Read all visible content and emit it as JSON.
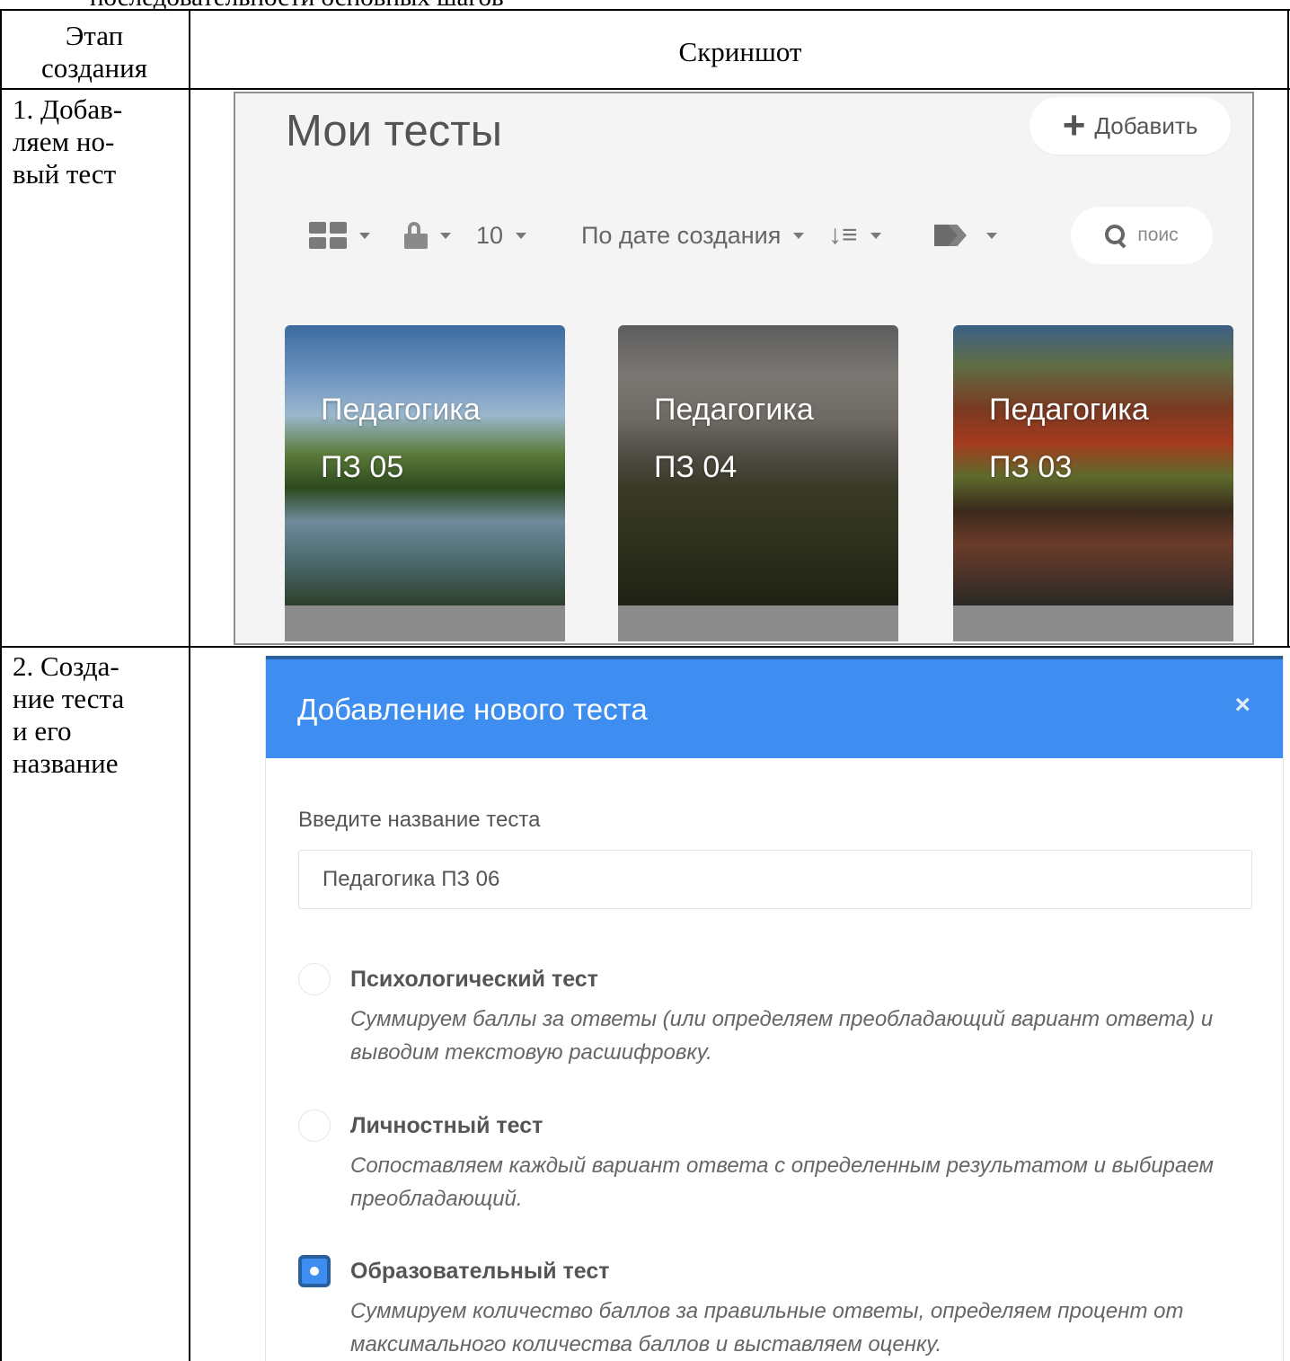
{
  "document": {
    "heading_fragment": "последовательности основных шагов",
    "table_header": {
      "stage": "Этап создания",
      "screenshot": "Скриншот"
    },
    "rows": [
      {
        "label": "1. Добав-\nляем но-\nвый тест"
      },
      {
        "label": "2. Созда-\nние теста\nи его\nназвание"
      }
    ]
  },
  "screen1": {
    "title": "Мои тесты",
    "add_button": "Добавить",
    "toolbar": {
      "view_icon": "grid-icon",
      "access_icon": "unlock-icon",
      "per_page": "10",
      "sort_by": "По дате создания",
      "sort_order_icon": "sort-desc-icon",
      "tags_icon": "tags-icon"
    },
    "search_placeholder": "поис",
    "cards": [
      {
        "line1": "Педагогика",
        "line2": "ПЗ 05"
      },
      {
        "line1": "Педагогика",
        "line2": "ПЗ 04"
      },
      {
        "line1": "Педагогика",
        "line2": "ПЗ 03"
      }
    ]
  },
  "screen2": {
    "modal_title": "Добавление нового теста",
    "close_label": "×",
    "name_label": "Введите название теста",
    "name_value": "Педагогика ПЗ 06",
    "options": [
      {
        "title": "Психологический тест",
        "description": "Суммируем баллы за ответы (или определяем преобладающий вариант ответа) и выводим текстовую расшифровку.",
        "checked": false
      },
      {
        "title": "Личностный тест",
        "description": "Сопоставляем каждый вариант ответа с определенным результатом и выбираем преобладающий.",
        "checked": false
      },
      {
        "title": "Образовательный тест",
        "description": "Суммируем количество баллов за правильные ответы, определяем процент от максимального количества баллов и выставляем оценку.",
        "checked": true
      }
    ],
    "colors": {
      "header": "#3d8ef0",
      "header_border": "#2a5f9e"
    }
  }
}
